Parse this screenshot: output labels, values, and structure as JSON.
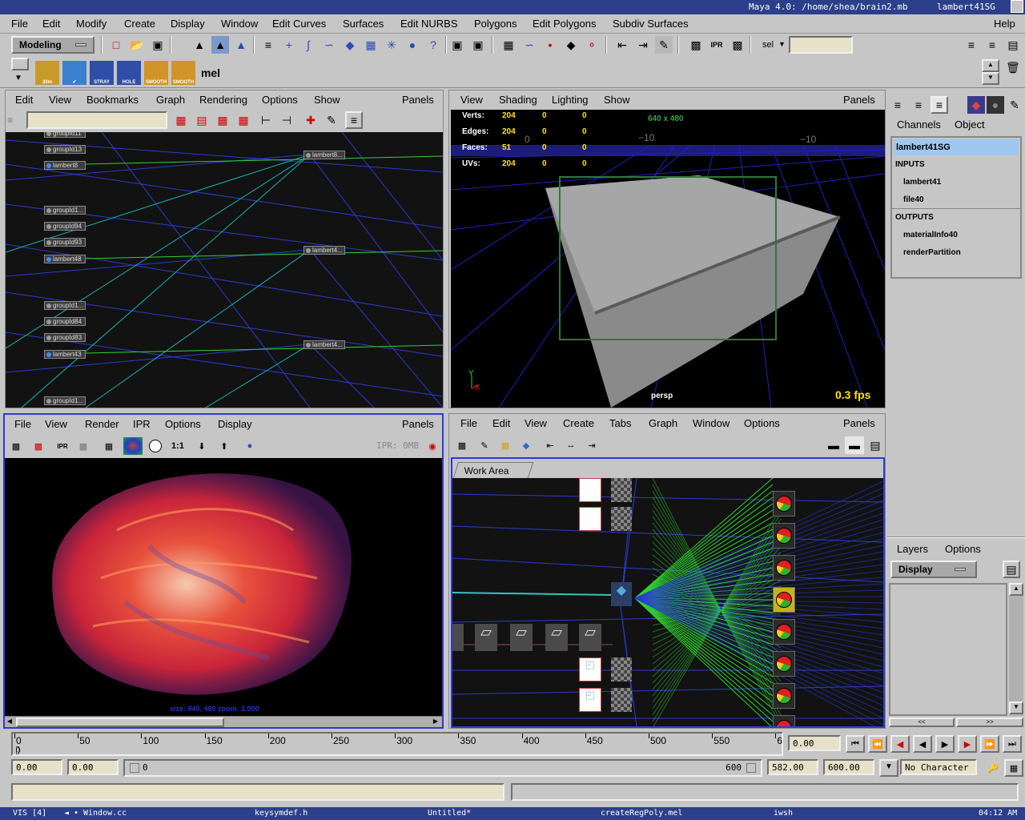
{
  "window": {
    "title": "Maya 4.0: /home/shea/brain2.mb",
    "title_right": "lambert41SG",
    "help": "Help"
  },
  "main_menu": [
    "File",
    "Edit",
    "Modify",
    "Create",
    "Display",
    "Window",
    "Edit Curves",
    "Surfaces",
    "Edit NURBS",
    "Polygons",
    "Edit Polygons",
    "Subdiv Surfaces"
  ],
  "toolbar": {
    "mode": "Modeling",
    "sel_label": "sel",
    "sel_value": ""
  },
  "shelf": {
    "items": [
      {
        "label": "30m",
        "color": "#c79a2a"
      },
      {
        "label": "",
        "color": "#3a7fd0"
      },
      {
        "label": "STRAY",
        "color": "#2f4ea8"
      },
      {
        "label": "HOLE",
        "color": "#2f4ea8"
      },
      {
        "label": "SMOOTH",
        "color": "#d09428"
      },
      {
        "label": "SMOOTH",
        "color": "#d09428"
      },
      {
        "label": "mel",
        "color": "#c6c6c6"
      }
    ]
  },
  "hypergraph": {
    "menu": [
      "Edit",
      "View",
      "Bookmarks",
      "Graph",
      "Rendering",
      "Options",
      "Show"
    ],
    "panels": "Panels",
    "nodes": [
      {
        "label": "groupId11",
        "blue": false
      },
      {
        "label": "groupId13",
        "blue": false
      },
      {
        "label": "lambert8",
        "blue": true
      },
      {
        "label": "groupId1...",
        "blue": false
      },
      {
        "label": "groupId94",
        "blue": false
      },
      {
        "label": "groupId93",
        "blue": false
      },
      {
        "label": "lambert48",
        "blue": true
      },
      {
        "label": "groupId1...",
        "blue": false
      },
      {
        "label": "groupId84",
        "blue": false
      },
      {
        "label": "groupId83",
        "blue": false
      },
      {
        "label": "lambert43",
        "blue": true
      },
      {
        "label": "groupId1...",
        "blue": false
      }
    ],
    "sg_nodes": [
      "lambert8...",
      "lambert4...",
      "lambert4..."
    ]
  },
  "persp": {
    "menu": [
      "View",
      "Shading",
      "Lighting",
      "Show"
    ],
    "panels": "Panels",
    "hud": [
      {
        "label": "Verts:",
        "values": [
          "204",
          "0",
          "0"
        ]
      },
      {
        "label": "Edges:",
        "values": [
          "204",
          "0",
          "0"
        ]
      },
      {
        "label": "Faces:",
        "values": [
          "51",
          "0",
          "0"
        ]
      },
      {
        "label": "UVs:",
        "values": [
          "204",
          "0",
          "0"
        ]
      }
    ],
    "resolution": "640 x 480",
    "grid_labels": [
      "0",
      "−10",
      "−10"
    ],
    "camera": "persp",
    "fps": "0.3 fps",
    "axis_y": "Y",
    "axis_x": "X"
  },
  "render_view": {
    "menu": [
      "File",
      "View",
      "Render",
      "IPR",
      "Options",
      "Display"
    ],
    "panels": "Panels",
    "ratio": "1:1",
    "ipr_status": "IPR: 0MB",
    "status_text": "size: 640, 480 zoom: 1.000"
  },
  "hypershade": {
    "menu": [
      "File",
      "Edit",
      "View",
      "Create",
      "Tabs",
      "Graph",
      "Window",
      "Options"
    ],
    "panels": "Panels",
    "tab": "Work Area"
  },
  "channel_box": {
    "tabs": [
      "Channels",
      "Object"
    ],
    "selected": "lambert41SG",
    "inputs_header": "INPUTS",
    "inputs": [
      "lambert41",
      "file40"
    ],
    "outputs_header": "OUTPUTS",
    "outputs": [
      "materialInfo40",
      "renderPartition"
    ]
  },
  "layers": {
    "tabs": [
      "Layers",
      "Options"
    ],
    "display": "Display",
    "scroll_left": "<<",
    "scroll_right": ">>"
  },
  "timeline": {
    "ticks": [
      "0",
      "50",
      "100",
      "150",
      "200",
      "250",
      "300",
      "350",
      "400",
      "450",
      "500",
      "550",
      "6"
    ],
    "current_time": "0.00",
    "current_frame_mark": "0"
  },
  "range": {
    "start": "0.00",
    "start2": "0.00",
    "slider_left": "0",
    "slider_right": "600",
    "end": "582.00",
    "end2": "600.00",
    "character": "No Character"
  },
  "taskbar": {
    "items": [
      "VIS [4]",
      "Window.cc",
      "keysymdef.h",
      "Untitled*",
      "createRegPoly.mel",
      "iwsh"
    ],
    "clock": "04:12 AM"
  }
}
